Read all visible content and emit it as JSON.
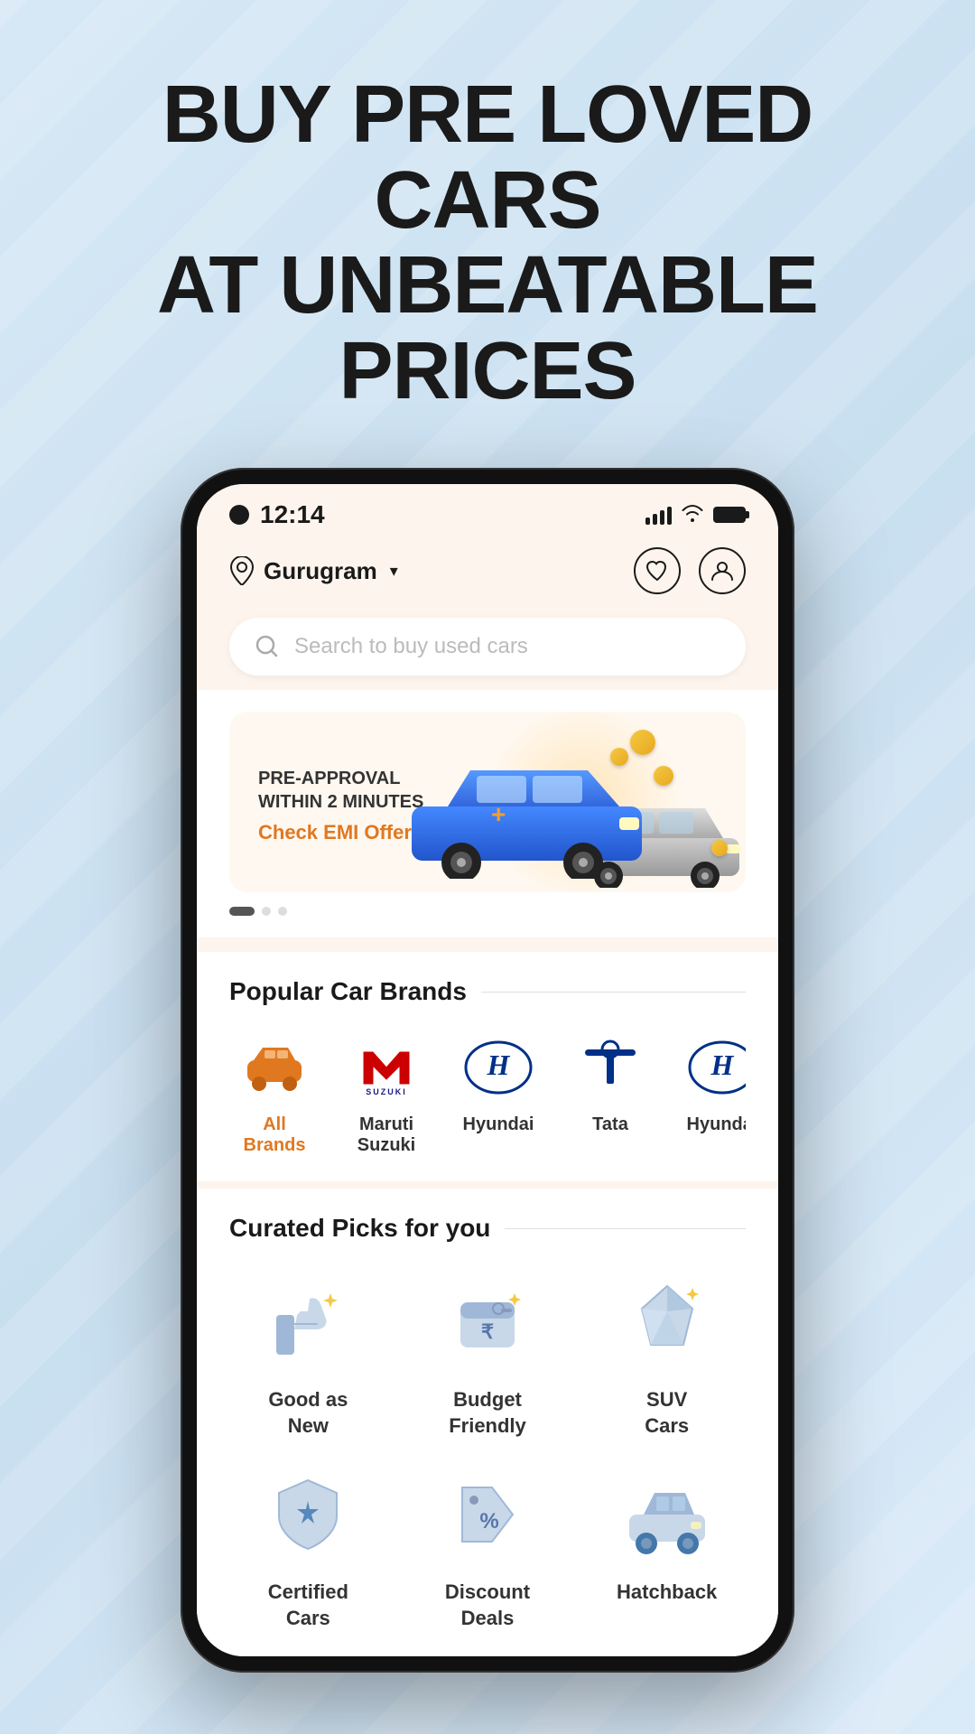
{
  "hero": {
    "title_line1": "BUY PRE LOVED CARS",
    "title_line2": "AT UNBEATABLE PRICES"
  },
  "status_bar": {
    "time": "12:14",
    "signal_bars": [
      8,
      12,
      16,
      20,
      22
    ],
    "wifi": "wifi",
    "battery": "battery"
  },
  "header": {
    "location": "Gurugram",
    "location_icon": "📍",
    "wishlist_icon": "♡",
    "profile_icon": "👤"
  },
  "search": {
    "placeholder": "Search to buy used cars"
  },
  "banner": {
    "title_line1": "PRE-APPROVAL",
    "title_line2": "WITHIN 2 MINUTES",
    "cta": "Check EMI Offer →",
    "dots": [
      "active",
      "inactive",
      "inactive"
    ]
  },
  "brands_section": {
    "title": "Popular Car Brands",
    "brands": [
      {
        "id": "all",
        "label": "All Brands",
        "type": "all"
      },
      {
        "id": "maruti",
        "label": "Maruti Suzuki",
        "type": "maruti"
      },
      {
        "id": "hyundai1",
        "label": "Hyundai",
        "type": "hyundai"
      },
      {
        "id": "tata",
        "label": "Tata",
        "type": "tata"
      },
      {
        "id": "hyundai2",
        "label": "Hyundai",
        "type": "hyundai"
      }
    ]
  },
  "curated_section": {
    "title": "Curated Picks for you",
    "picks": [
      {
        "id": "good-as-new",
        "label": "Good as\nNew",
        "icon": "thumb"
      },
      {
        "id": "budget-friendly",
        "label": "Budget\nFriendly",
        "icon": "wallet"
      },
      {
        "id": "suv-cars",
        "label": "SUV\nCars",
        "icon": "diamond"
      }
    ],
    "picks_bottom": [
      {
        "id": "certified",
        "label": "Certified\nCars",
        "icon": "shield"
      },
      {
        "id": "discount",
        "label": "Discount\nDeals",
        "icon": "tag"
      },
      {
        "id": "hatchback",
        "label": "Hatchback",
        "icon": "car-small"
      }
    ]
  },
  "colors": {
    "orange": "#e07820",
    "blue": "#003087",
    "red": "#cc0000",
    "bg_peach": "#fdf5ed",
    "white": "#ffffff"
  }
}
